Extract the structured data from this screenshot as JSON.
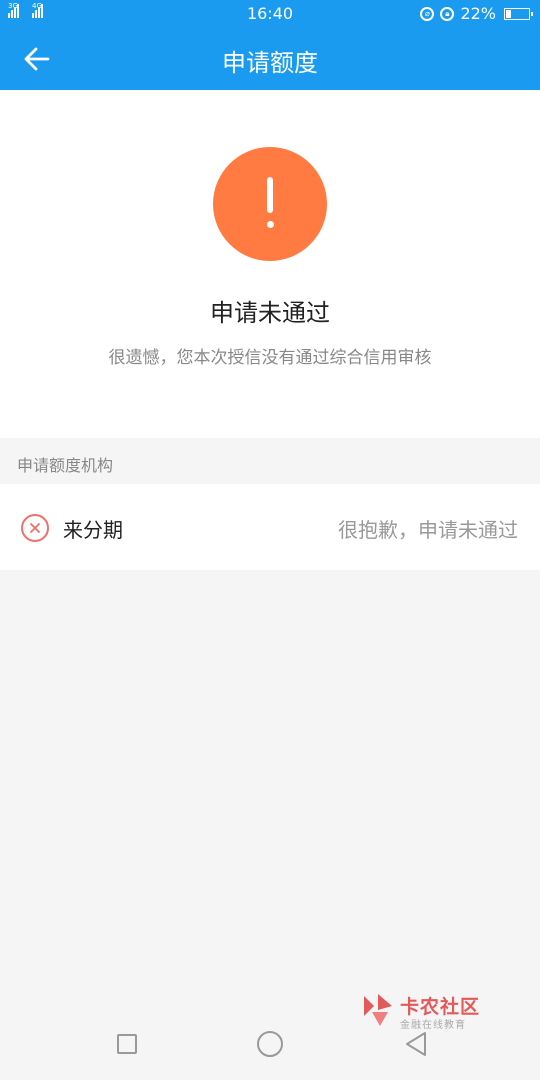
{
  "status_bar": {
    "sim1_tag": "3G",
    "sim2_tag": "4G",
    "time": "16:40",
    "battery_percent": "22%",
    "battery_level": 0.22
  },
  "header": {
    "title": "申请额度",
    "back_icon": "arrow-left-icon"
  },
  "result": {
    "icon": "exclamation-icon",
    "accent_color": "#ff7b42",
    "title": "申请未通过",
    "description": "很遗憾，您本次授信没有通过综合信用审核"
  },
  "section": {
    "header": "申请额度机构"
  },
  "org": {
    "icon": "close-circle-icon",
    "name": "来分期",
    "status": "很抱歉，申请未通过"
  },
  "watermark": {
    "title": "卡农社区",
    "subtitle": "金融在线教育"
  },
  "system_nav": {
    "recent": "square-icon",
    "home": "circle-icon",
    "back": "triangle-back-icon"
  },
  "colors": {
    "brand": "#1a9bf0",
    "error": "#f0706a"
  }
}
